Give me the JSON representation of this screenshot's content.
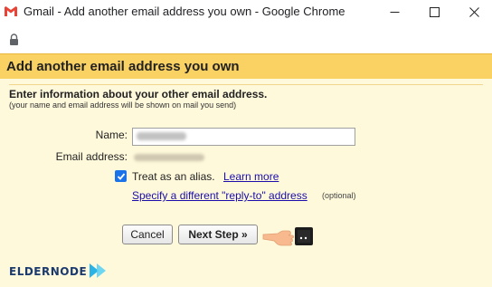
{
  "window": {
    "title": "Gmail - Add another email address you own - Google Chrome",
    "icon": "gmail-icon"
  },
  "form": {
    "header": "Add another email address you own",
    "intro": "Enter information about your other email address.",
    "intro_sub": "(your name and email address will be shown on mail you send)",
    "name_label": "Name:",
    "email_label": "Email address:",
    "alias_label": "Treat as an alias.",
    "alias_checked": true,
    "learn_more": "Learn more",
    "replyto_link": "Specify a different \"reply-to\" address",
    "optional": "(optional)",
    "cancel_button": "Cancel",
    "next_button": "Next Step »"
  },
  "branding": {
    "logo_text": "eldernode"
  },
  "colors": {
    "header_bg": "#fad163",
    "panel_bg": "#fff9db",
    "link": "#1a0dab",
    "checkbox": "#1a73e8",
    "logo": "#1a3a6e",
    "logo_accent": "#2bb3e6"
  }
}
